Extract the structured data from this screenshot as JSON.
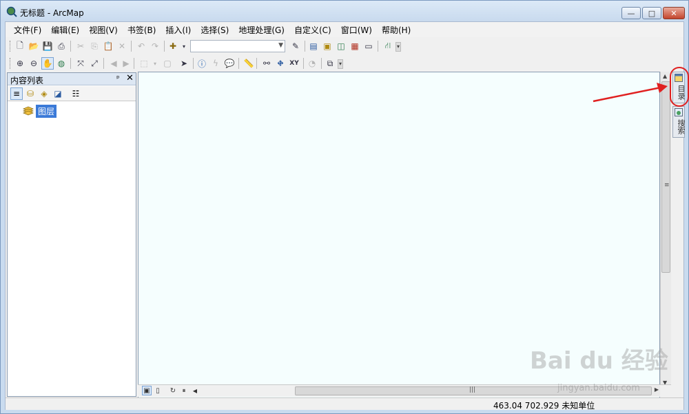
{
  "window": {
    "title": "无标题 - ArcMap",
    "minimize_glyph": "—",
    "maximize_glyph": "□",
    "close_glyph": "✕"
  },
  "menu": [
    "文件(F)",
    "编辑(E)",
    "视图(V)",
    "书签(B)",
    "插入(I)",
    "选择(S)",
    "地理处理(G)",
    "自定义(C)",
    "窗口(W)",
    "帮助(H)"
  ],
  "toc": {
    "title": "内容列表",
    "pin_glyph": "ᵖ",
    "close_glyph": "✕",
    "layer_label": "图层"
  },
  "toolbar": {
    "scale_value": ""
  },
  "dock": {
    "catalog_label": "目录",
    "search_label": "搜索"
  },
  "status": {
    "coords": "463.04   702.929 未知单位"
  },
  "watermark": {
    "brand": "Bai du 经验",
    "url": "jingyan.baidu.com"
  },
  "colors": {
    "map_background": "#f5fefe",
    "annotation_red": "#e02020",
    "selection_blue": "#3b7ad8"
  }
}
